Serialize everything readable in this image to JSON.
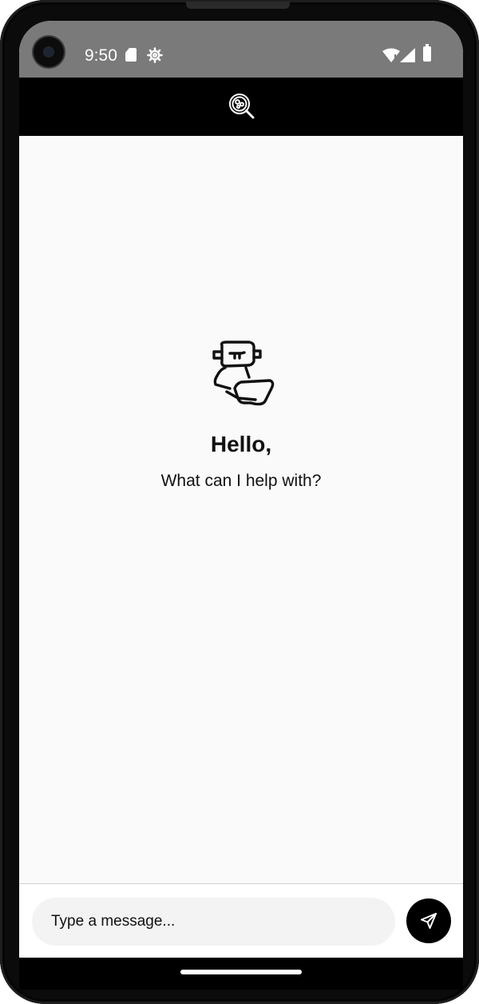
{
  "status_bar": {
    "time": "9:50",
    "icons": [
      "sd-card-icon",
      "gear-icon",
      "wifi-icon",
      "signal-icon",
      "battery-icon"
    ]
  },
  "app_bar": {
    "logo_icon": "magnifier-logo-icon"
  },
  "welcome": {
    "illustration": "robot-with-laptop-icon",
    "title": "Hello,",
    "subtitle": "What can I help with?"
  },
  "composer": {
    "placeholder": "Type a message...",
    "value": "",
    "send_icon": "send-icon"
  },
  "colors": {
    "status_bar_bg": "#7a7a7a",
    "app_bar_bg": "#000000",
    "screen_bg": "#fafafa",
    "input_bg": "#f3f3f3",
    "send_button_bg": "#000000"
  }
}
